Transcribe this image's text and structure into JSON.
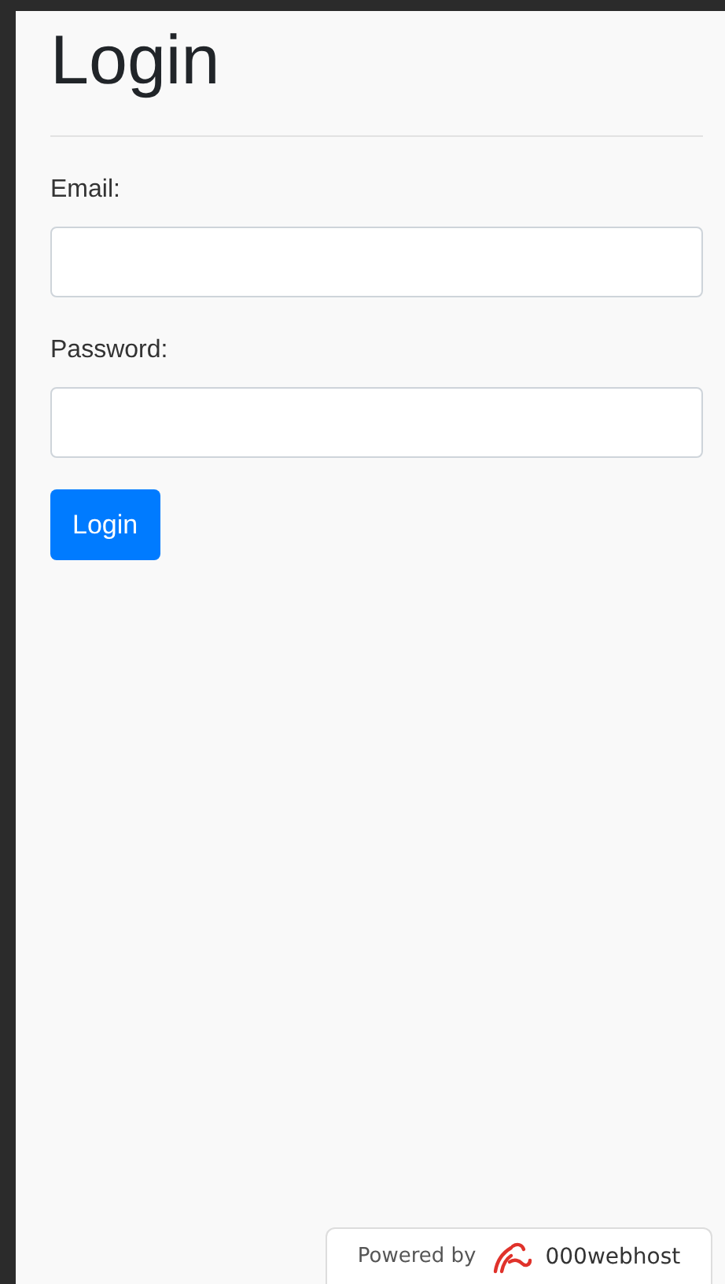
{
  "title": "Login",
  "fields": [
    {
      "label": "Email:"
    },
    {
      "label": "Password:"
    }
  ],
  "button": "Login",
  "badge": {
    "prefix": "Powered by",
    "brand": "000webhost"
  }
}
